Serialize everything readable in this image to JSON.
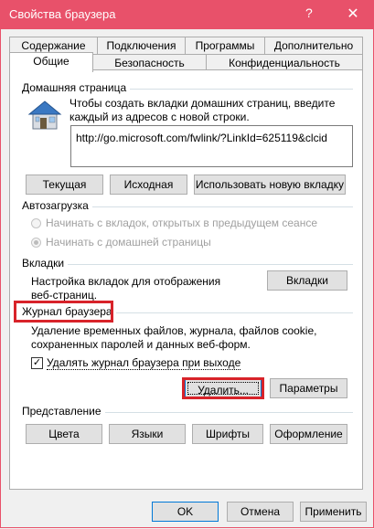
{
  "window": {
    "title": "Свойства браузера",
    "help_symbol": "?",
    "close_symbol": "✕",
    "accent_color": "#e8516a"
  },
  "tabs_row1": [
    "Содержание",
    "Подключения",
    "Программы",
    "Дополнительно"
  ],
  "tabs_row2": [
    "Общие",
    "Безопасность",
    "Конфиденциальность"
  ],
  "active_tab": "Общие",
  "home_page": {
    "group_title": "Домашняя страница",
    "description": "Чтобы создать вкладки домашних страниц, введите каждый из адресов с новой строки.",
    "description_line1": "Чтобы создать вкладки домашних страниц, введите",
    "description_line2": "каждый из адресов с новой строки.",
    "url_value": "http://go.microsoft.com/fwlink/?LinkId=625119&clcid",
    "btn_current": "Текущая",
    "btn_default": "Исходная",
    "btn_new_tab": "Использовать новую вкладку",
    "icon": "house-icon"
  },
  "startup": {
    "group_title": "Автозагрузка",
    "option1": "Начинать с вкладок, открытых в предыдущем сеансе",
    "option2": "Начинать с домашней страницы",
    "selected": "option2"
  },
  "tabs_section": {
    "group_title": "Вкладки",
    "description_line1": "Настройка вкладок для отображения",
    "description_line2": "веб-страниц.",
    "btn_tabs": "Вкладки"
  },
  "history": {
    "group_title": "Журнал браузера",
    "description_line1": "Удаление временных файлов, журнала, файлов cookie,",
    "description_line2": "сохраненных паролей и данных веб-форм.",
    "checkbox_label": "Удалять журнал браузера при выходе",
    "checkbox_checked": true,
    "checkbox_symbol": "✓",
    "btn_delete": "Удалить...",
    "btn_settings": "Параметры",
    "highlight_color": "#d8232a"
  },
  "appearance": {
    "group_title": "Представление",
    "btn_colors": "Цвета",
    "btn_languages": "Языки",
    "btn_fonts": "Шрифты",
    "btn_accessibility": "Оформление"
  },
  "footer": {
    "btn_ok": "OK",
    "btn_cancel": "Отмена",
    "btn_apply": "Применить"
  }
}
